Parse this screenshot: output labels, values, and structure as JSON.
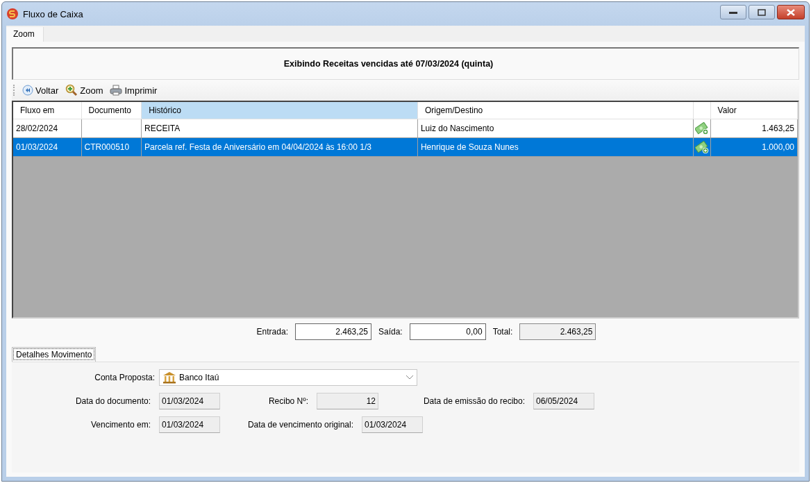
{
  "window": {
    "title": "Fluxo de Caixa"
  },
  "tabs": [
    {
      "label": "Zoom",
      "selected": true
    }
  ],
  "banner": {
    "text": "Exibindo Receitas vencidas até 07/03/2024 (quinta)"
  },
  "toolbar": [
    {
      "kind": "back",
      "label": "Voltar"
    },
    {
      "kind": "zoom",
      "label": "Zoom"
    },
    {
      "kind": "print",
      "label": "Imprimir"
    }
  ],
  "table": {
    "columns": [
      {
        "label": "Fluxo em",
        "sorted": false
      },
      {
        "label": "Documento",
        "sorted": false
      },
      {
        "label": "Histórico",
        "sorted": true
      },
      {
        "label": "Origem/Destino",
        "sorted": false
      },
      {
        "sorted": false
      },
      {
        "label": "Valor",
        "sorted": false
      }
    ],
    "rows": [
      {
        "date": "28/02/2024",
        "document": "",
        "history": "RECEITA",
        "party": "Luiz do Nascimento",
        "value": "1.463,25",
        "selected": false
      },
      {
        "date": "01/03/2024",
        "document": "CTR000510",
        "history": "Parcela ref. Festa de Aniversário em 04/04/2024 às 16:00 1/3",
        "party": "Henrique de Souza Nunes",
        "value": "1.000,00",
        "selected": true
      }
    ]
  },
  "totals": [
    {
      "label": "Entrada:",
      "value": "2.463,25",
      "readonly": false
    },
    {
      "label": "Saída:",
      "value": "0,00",
      "readonly": false
    },
    {
      "label": "Total:",
      "value": "2.463,25",
      "readonly": true
    }
  ],
  "details_tab": {
    "label": "Detalhes Movimento",
    "selected": true
  },
  "details": {
    "account_label": "Conta Proposta:",
    "account_value": "Banco Itaú",
    "document_date_label": "Data do documento:",
    "document_date": "01/03/2024",
    "receipt_label": "Recibo Nº:",
    "receipt": "12",
    "receipt_date_label": "Data de emissão do recibo:",
    "receipt_date": "06/05/2024",
    "due_label": "Vencimento em:",
    "due": "01/03/2024",
    "original_due_label": "Data de vencimento original:",
    "original_due": "01/03/2024"
  }
}
